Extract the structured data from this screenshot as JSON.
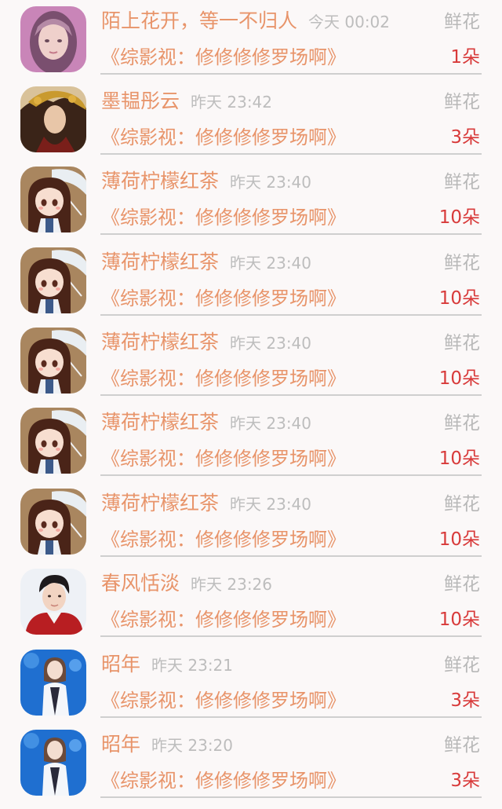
{
  "colors": {
    "name": "#e8946a",
    "time": "#bdbdbd",
    "label": "#b8b8b8",
    "count": "#d83a3a"
  },
  "rows": [
    {
      "user": "陌上花开，等一不归人",
      "time": "今天 00:02",
      "gift": "鲜花",
      "book": "《综影视：修修修修罗场啊》",
      "count": "1朵",
      "avatar": "girl-avatar-icon"
    },
    {
      "user": "墨韫彤云",
      "time": "昨天 23:42",
      "gift": "鲜花",
      "book": "《综影视：修修修修罗场啊》",
      "count": "3朵",
      "avatar": "costume-avatar-icon"
    },
    {
      "user": "薄荷柠檬红茶",
      "time": "昨天 23:40",
      "gift": "鲜花",
      "book": "《综影视：修修修修罗场啊》",
      "count": "10朵",
      "avatar": "cartoon-girl-avatar-icon"
    },
    {
      "user": "薄荷柠檬红茶",
      "time": "昨天 23:40",
      "gift": "鲜花",
      "book": "《综影视：修修修修罗场啊》",
      "count": "10朵",
      "avatar": "cartoon-girl-avatar-icon"
    },
    {
      "user": "薄荷柠檬红茶",
      "time": "昨天 23:40",
      "gift": "鲜花",
      "book": "《综影视：修修修修罗场啊》",
      "count": "10朵",
      "avatar": "cartoon-girl-avatar-icon"
    },
    {
      "user": "薄荷柠檬红茶",
      "time": "昨天 23:40",
      "gift": "鲜花",
      "book": "《综影视：修修修修罗场啊》",
      "count": "10朵",
      "avatar": "cartoon-girl-avatar-icon"
    },
    {
      "user": "薄荷柠檬红茶",
      "time": "昨天 23:40",
      "gift": "鲜花",
      "book": "《综影视：修修修修罗场啊》",
      "count": "10朵",
      "avatar": "cartoon-girl-avatar-icon"
    },
    {
      "user": "春风恬淡",
      "time": "昨天 23:26",
      "gift": "鲜花",
      "book": "《综影视：修修修修罗场啊》",
      "count": "10朵",
      "avatar": "young-man-avatar-icon"
    },
    {
      "user": "昭年",
      "time": "昨天 23:21",
      "gift": "鲜花",
      "book": "《综影视：修修修修罗场啊》",
      "count": "3朵",
      "avatar": "stage-singer-avatar-icon"
    },
    {
      "user": "昭年",
      "time": "昨天 23:20",
      "gift": "鲜花",
      "book": "《综影视：修修修修罗场啊》",
      "count": "3朵",
      "avatar": "stage-singer-avatar-icon"
    }
  ]
}
